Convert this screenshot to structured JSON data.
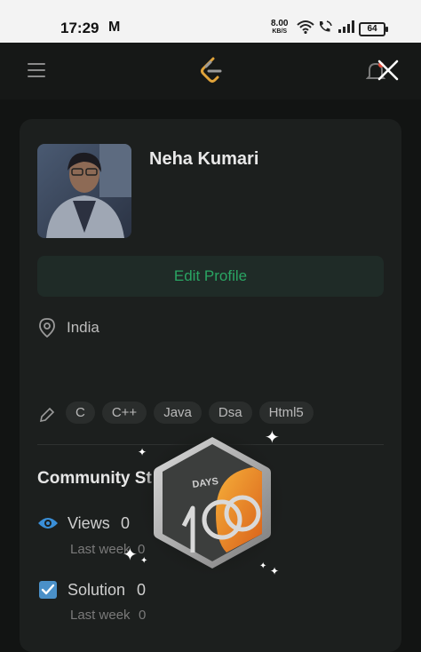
{
  "status_bar": {
    "time": "17:29",
    "mail_glyph": "M",
    "net_speed": "8.00",
    "net_unit": "KB/S",
    "battery": "64"
  },
  "header": {
    "menu_icon": "hamburger-icon",
    "logo_icon": "leetcode-logo",
    "close_icon": "close-icon"
  },
  "profile": {
    "name": "Neha Kumari",
    "edit_label": "Edit Profile",
    "location": "India",
    "skills": [
      "C",
      "C++",
      "Java",
      "Dsa",
      "Html5"
    ]
  },
  "community": {
    "title": "Community St",
    "views_label": "Views",
    "views_value": "0",
    "views_sub_label": "Last week",
    "views_sub_value": "0",
    "solution_label": "Solution",
    "solution_value": "0",
    "solution_sub_label": "Last week",
    "solution_sub_value": "0"
  },
  "badge": {
    "text": "DAYS"
  },
  "colors": {
    "accent_green": "#2aa563",
    "accent_blue": "#3a8fd8",
    "badge_orange": "#f08a1c"
  }
}
